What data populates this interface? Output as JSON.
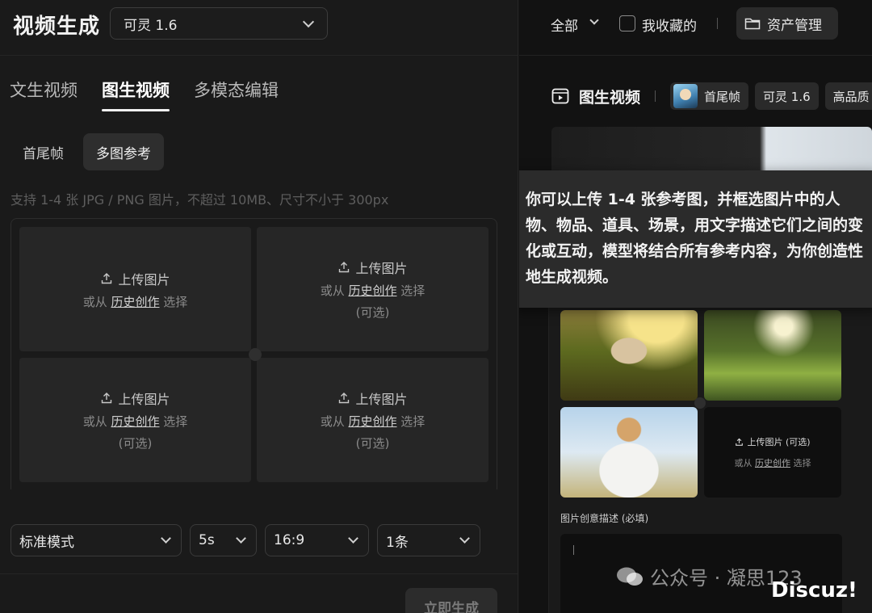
{
  "header": {
    "title": "视频生成",
    "model": "可灵 1.6"
  },
  "main_tabs": [
    {
      "label": "文生视频",
      "active": false
    },
    {
      "label": "图生视频",
      "active": true
    },
    {
      "label": "多模态编辑",
      "active": false
    }
  ],
  "sub_tabs": [
    {
      "label": "首尾帧",
      "active": false
    },
    {
      "label": "多图参考",
      "active": true
    }
  ],
  "hint": "支持 1-4 张 JPG / PNG 图片，不超过 10MB、尺寸不小于 300px",
  "upload_slots": [
    {
      "upload": "上传图片",
      "from": "或从",
      "link": "历史创作",
      "choose": "选择",
      "optional": ""
    },
    {
      "upload": "上传图片",
      "from": "或从",
      "link": "历史创作",
      "choose": "选择",
      "optional": "(可选)"
    },
    {
      "upload": "上传图片",
      "from": "或从",
      "link": "历史创作",
      "choose": "选择",
      "optional": "(可选)"
    },
    {
      "upload": "上传图片",
      "from": "或从",
      "link": "历史创作",
      "choose": "选择",
      "optional": "(可选)"
    }
  ],
  "settings": {
    "mode": "标准模式",
    "duration": "5s",
    "ratio": "16:9",
    "count": "1条"
  },
  "generate_button": "立即生成",
  "right": {
    "filter": "全部",
    "favorites": "我收藏的",
    "asset_manage": "资产管理",
    "task_title": "图生视频",
    "chips": [
      "首尾帧",
      "可灵 1.6",
      "高品质"
    ],
    "tooltip": "你可以上传 1-4 张参考图，并框选图片中的人物、物品、道具、场景，用文字描述它们之间的变化或互动，模型将结合所有参考内容，为你创造性地生成视频。",
    "mini_upload": "上传图片 (可选)",
    "mini_from": "或从",
    "mini_link": "历史创作",
    "mini_choose": "选择",
    "desc_label": "图片创意描述 (必填)"
  },
  "watermark": {
    "text1": "公众号 · 凝思123",
    "text2": "Discuz!"
  }
}
